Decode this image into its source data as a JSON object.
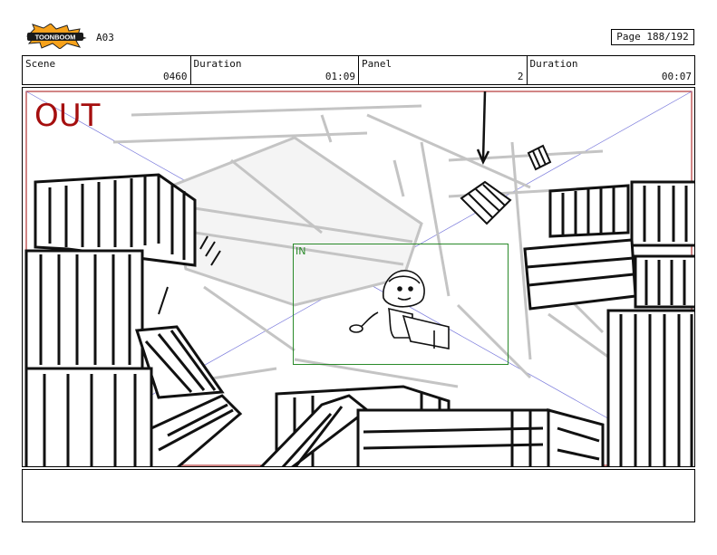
{
  "header": {
    "logo_text": "TOONBOOM",
    "sheet": "A03",
    "page": "Page 188/192"
  },
  "info": {
    "scene_label": "Scene",
    "scene_value": "0460",
    "duration1_label": "Duration",
    "duration1_value": "01:09",
    "panel_label": "Panel",
    "panel_value": "2",
    "duration2_label": "Duration",
    "duration2_value": "00:07"
  },
  "panel": {
    "out_label": "OUT",
    "in_label": "IN"
  },
  "colors": {
    "out": "#a50e0e",
    "in": "#2a8a2a",
    "guide": "#7b7bdc"
  },
  "notes": ""
}
